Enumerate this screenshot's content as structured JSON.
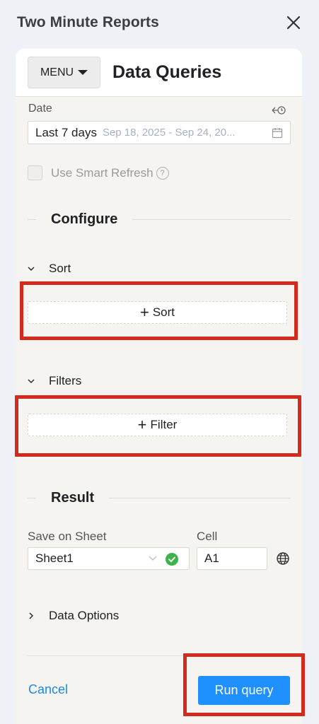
{
  "app": {
    "title": "Two Minute Reports"
  },
  "header": {
    "menu_label": "MENU",
    "title": "Data Queries"
  },
  "date": {
    "label": "Date",
    "value": "Last 7 days",
    "range": "Sep 18, 2025 - Sep 24, 20..."
  },
  "smart_refresh": {
    "label": "Use Smart Refresh",
    "checked": false
  },
  "configure": {
    "title": "Configure",
    "sort": {
      "label": "Sort",
      "button_label": "Sort"
    },
    "filters": {
      "label": "Filters",
      "button_label": "Filter"
    }
  },
  "result": {
    "title": "Result",
    "sheet_label": "Save on Sheet",
    "sheet_value": "Sheet1",
    "cell_label": "Cell",
    "cell_value": "A1"
  },
  "data_options": {
    "label": "Data Options"
  },
  "footer": {
    "cancel_label": "Cancel",
    "run_label": "Run query"
  },
  "colors": {
    "accent": "#1e90ff",
    "highlight": "#d32a1e",
    "success": "#3bb54a"
  }
}
